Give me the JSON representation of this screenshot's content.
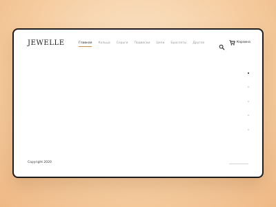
{
  "brand": {
    "logo_text": "JEWELLE"
  },
  "nav": {
    "items": [
      {
        "label": "Главная",
        "active": true
      },
      {
        "label": "Кольца",
        "active": false
      },
      {
        "label": "Серьги",
        "active": false
      },
      {
        "label": "Подвески",
        "active": false
      },
      {
        "label": "Цепи",
        "active": false
      },
      {
        "label": "Браслеты",
        "active": false
      },
      {
        "label": "Другое",
        "active": false
      }
    ]
  },
  "header": {
    "search_icon": "search-icon",
    "cart_icon": "cart-icon",
    "cart_label": "Корзина"
  },
  "slider": {
    "dot_count": 5,
    "active_index": 0
  },
  "footer": {
    "copyright": "Copyright 2020"
  },
  "colors": {
    "background": "#f6cfa4",
    "window": "#ffffff",
    "window_border": "#1c1c1c",
    "text_primary": "#1a1a1a",
    "text_muted": "#9a9a9a",
    "accent": "#c98a45"
  }
}
